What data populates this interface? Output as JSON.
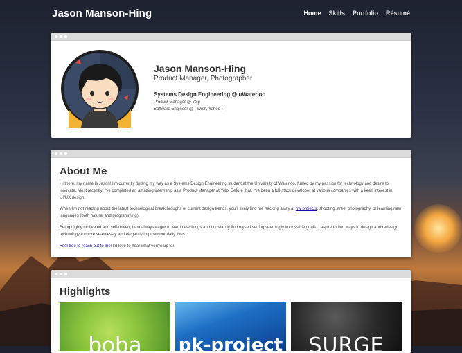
{
  "nav": {
    "brand": "Jason Manson-Hing",
    "links": [
      "Home",
      "Skills",
      "Portfolio",
      "Résumé"
    ]
  },
  "profile": {
    "name": "Jason Manson-Hing",
    "title": "Product Manager, Photographer",
    "school": "Systems Design Engineering @ uWaterloo",
    "roles": [
      "Product Manager @ Yelp",
      "Software Engineer @ { Wish, Yahoo }"
    ]
  },
  "about": {
    "heading": "About Me",
    "p1": "Hi there, my name is Jason! I'm currently finding my way as a Systems Design Engineering student at the University of Waterloo, fueled by my passion for technology and desire to innovate. Most recently, I've completed an amazing internship as a Product Manager at Yelp. Before that, I've been a full-stack developer at various companies with a keen interest in UI/UX design.",
    "p2_before": "When I'm not reading about the latest technological breakthroughs or current design trends, you'll likely find me hacking away at ",
    "p2_link": "my projects",
    "p2_after": ", shooting street photography, or learning new languages (both natural and programming).",
    "p3": "Being highly motivated and self-driven, I am always eager to learn new things and constantly find myself setting seemingly impossible goals. I aspire to find ways to design and redesign technology to more seamlessly and elegantly improve our daily lives.",
    "p4_link": "Feel free to reach out to me",
    "p4_after": "! I'd love to hear what you're up to!"
  },
  "highlights": {
    "heading": "Highlights",
    "tiles": [
      "boba",
      "pk-project",
      "SURGE"
    ]
  }
}
